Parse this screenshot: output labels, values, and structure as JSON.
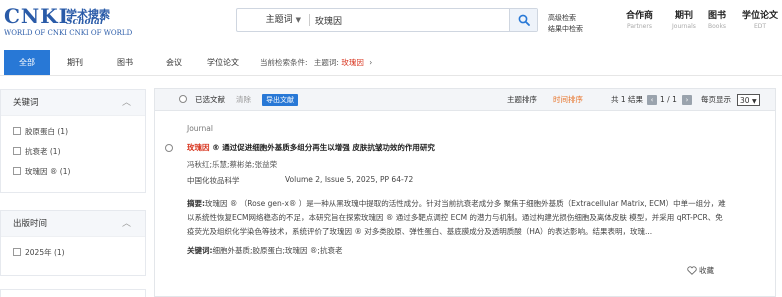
{
  "logo": {
    "main": "CNKI",
    "cn": "学术搜索",
    "scholar": "Scholar",
    "sub": "WORLD OF CNKI CNKI OF WORLD"
  },
  "search": {
    "field": "主题词",
    "query": "玫瑰因"
  },
  "adv_links": {
    "advanced": "高级检索",
    "within": "结果中检索"
  },
  "nav": [
    {
      "cn": "合作商",
      "en": "Partners"
    },
    {
      "cn": "期刊",
      "en": "Journals"
    },
    {
      "cn": "图书",
      "en": "Books"
    },
    {
      "cn": "学位论文",
      "en": "EDT"
    }
  ],
  "tabs": [
    "全部",
    "期刊",
    "图书",
    "会议",
    "学位论文"
  ],
  "condition": {
    "label": "当前检索条件:",
    "field": "主题词:",
    "value": "玫瑰因",
    "arrow": "›"
  },
  "sidebar": {
    "keywords": {
      "title": "关键词",
      "items": [
        "胶原蛋白 (1)",
        "抗衰老 (1)",
        "玫瑰因 ® (1)"
      ]
    },
    "pubtime": {
      "title": "出版时间",
      "items": [
        "2025年 (1)"
      ]
    }
  },
  "toolbar": {
    "selected": "已选文献",
    "clear": "清除",
    "export": "导出文献",
    "sort_topic": "主题排序",
    "sort_time": "时间排序",
    "total": "共 1 结果",
    "page": "1 / 1",
    "per_page_label": "每页显示",
    "per_page": "30"
  },
  "record": {
    "type": "Journal",
    "title_hl": "玫瑰因",
    "title_rest": " ® 通过促进细胞外基质多组分再生以增强 皮肤抗皱功效的作用研究",
    "authors": "冯秋红;乐慧;蔡彬弟;张益荣",
    "source": "中国化妆品科学",
    "volume": "Volume 2, Issue 5, 2025, PP 64-72",
    "abstract_label": "摘要:",
    "abstract": "玫瑰因 ® （Rose gen-x® ）是一种从黑玫瑰中提取的活性成分。针对当前抗衰老成分多 聚焦于细胞外基质（Extracellular Matrix, ECM）中单一组分，难以系统性恢复ECM网络稳态的不足，本研究旨在探索玫瑰因 ® 通过多靶点调控 ECM 的潜力与机制。通过构建光损伤细胞及离体皮肤 模型，并采用 qRT-PCR、免疫荧光及组织化学染色等技术，系统评价了玫瑰因 ® 对多类胶原、弹性蛋白、基底膜成分及透明质酸（HA）的表达影响。结果表明，玫瑰...",
    "keywords_label": "关键词:",
    "keywords": "细胞外基质;胶原蛋白;玫瑰因 ®;抗衰老",
    "favorite": "收藏"
  },
  "colors": {
    "brand": "#2a5ba8",
    "accent": "#2878d6",
    "highlight": "#d8351f"
  }
}
